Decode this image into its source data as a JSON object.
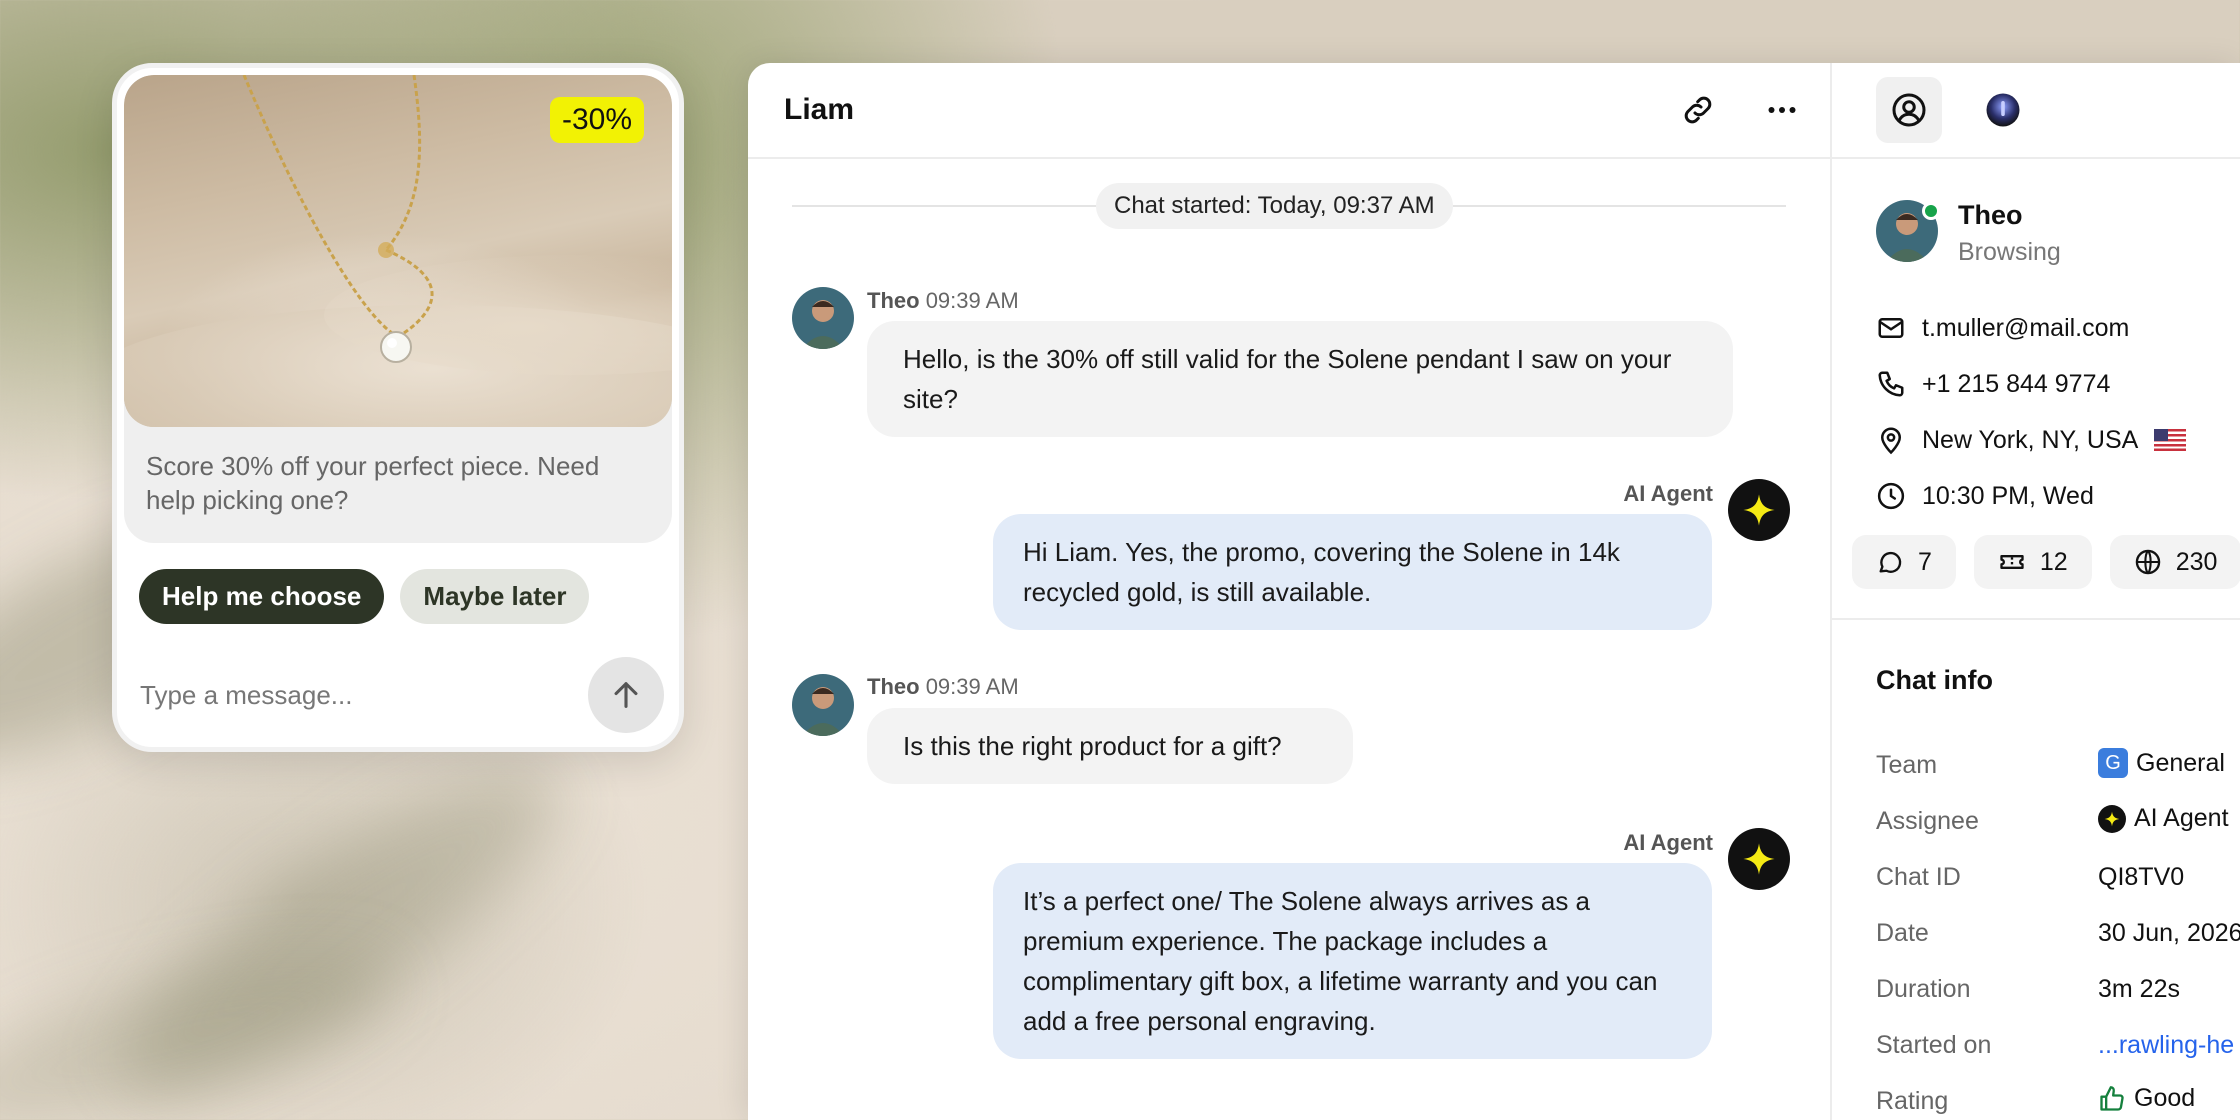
{
  "widget": {
    "discount_badge": "-30%",
    "promo_text": "Score 30% off your perfect piece. Need help picking one?",
    "quick_replies": [
      "Help me choose",
      "Maybe later"
    ],
    "composer_placeholder": "Type a message..."
  },
  "conversation": {
    "title": "Liam",
    "chat_started": "Chat started: Today, 09:37 AM",
    "messages": [
      {
        "sender": "Theo",
        "time": "09:39 AM",
        "text": "Hello, is the 30% off still valid for the Solene pendant I saw on your site?"
      },
      {
        "sender": "AI Agent",
        "text": "Hi Liam. Yes, the promo, covering the Solene in 14k recycled gold, is still available."
      },
      {
        "sender": "Theo",
        "time": "09:39 AM",
        "text": "Is this the right product for a gift?"
      },
      {
        "sender": "AI Agent",
        "text": "It’s a perfect one/ The Solene always arrives as a premium experience. The package includes a complimentary gift box, a lifetime warranty and you can add a free personal engraving."
      }
    ]
  },
  "contact": {
    "name": "Theo",
    "status": "Browsing",
    "email": "t.muller@mail.com",
    "phone": "+1 215 844 9774",
    "location": "New York, NY, USA",
    "local_time": "10:30 PM, Wed",
    "stats": {
      "chats": "7",
      "tickets": "12",
      "visits": "230"
    }
  },
  "chat_info": {
    "title": "Chat info",
    "rows": [
      {
        "label": "Team",
        "value": "General"
      },
      {
        "label": "Assignee",
        "value": "AI Agent"
      },
      {
        "label": "Chat ID",
        "value": "QI8TV0"
      },
      {
        "label": "Date",
        "value": "30 Jun, 2026"
      },
      {
        "label": "Duration",
        "value": "3m 22s"
      },
      {
        "label": "Started on",
        "value": "...rawling-he"
      },
      {
        "label": "Rating",
        "value": "Good"
      }
    ]
  },
  "colors": {
    "ai_bubble": "#e2ebf8",
    "user_bubble": "#f3f3f3",
    "badge": "#f2f204",
    "primary_button": "#2d3526",
    "online": "#17a34a",
    "link": "#2563eb"
  }
}
